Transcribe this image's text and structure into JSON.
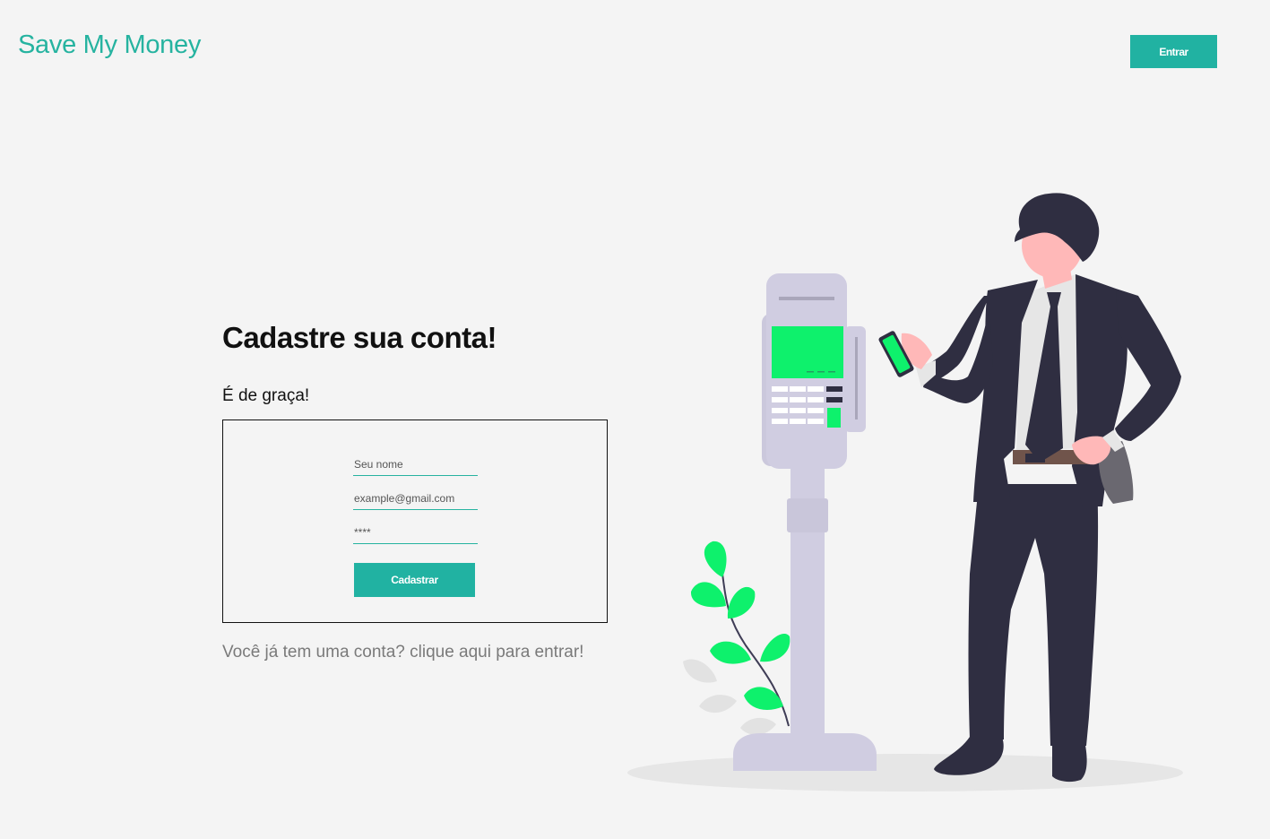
{
  "header": {
    "brand": "Save My Money",
    "login_button": "Entrar"
  },
  "main": {
    "title": "Cadastre sua conta!",
    "subtitle": "É de graça!",
    "form": {
      "name_placeholder": "Seu nome",
      "email_placeholder": "example@gmail.com",
      "password_placeholder": "****",
      "submit_label": "Cadastrar"
    },
    "login_link": "Você já tem uma conta? clique aqui para entrar!"
  },
  "colors": {
    "accent": "#21b2a2",
    "brand_text": "#26b3a0",
    "background": "#f4f4f4",
    "illustration_green": "#0ef16c",
    "suit": "#2f2e41",
    "terminal": "#d0cde1"
  },
  "illustration": {
    "name": "payment-terminal-man-illustration"
  }
}
